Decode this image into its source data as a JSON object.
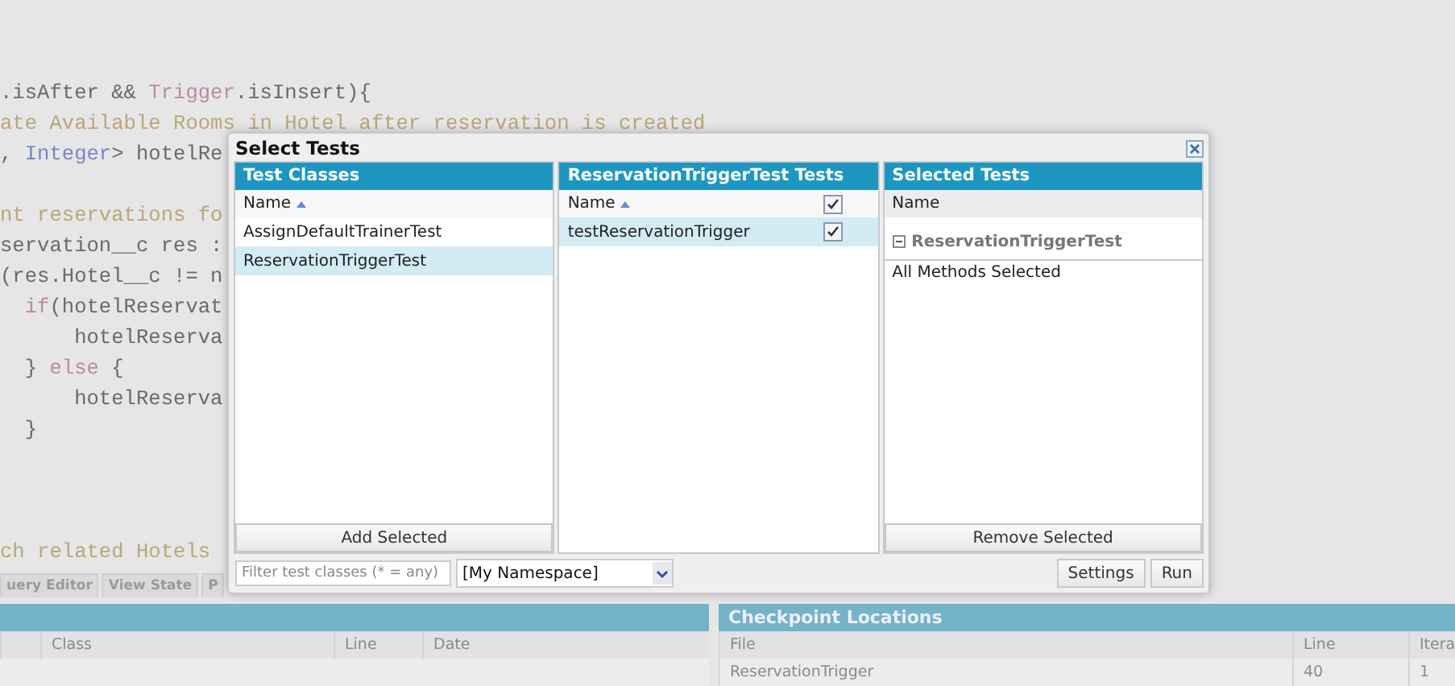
{
  "code_lines": [
    {
      "kind": "code",
      "segments": [
        {
          "text": ".isAfter && ",
          "kind": "plain"
        },
        {
          "text": "Trigger",
          "kind": "keyword"
        },
        {
          "text": ".isInsert){",
          "kind": "plain"
        }
      ]
    },
    {
      "kind": "code",
      "segments": [
        {
          "text": "ate Available Rooms in Hotel after reservation is created",
          "kind": "comment"
        }
      ]
    },
    {
      "kind": "code",
      "segments": [
        {
          "text": ", ",
          "kind": "plain"
        },
        {
          "text": "Integer",
          "kind": "type"
        },
        {
          "text": "> hotelRe",
          "kind": "plain"
        }
      ]
    },
    {
      "kind": "blank"
    },
    {
      "kind": "code",
      "segments": [
        {
          "text": "nt reservations fo",
          "kind": "comment"
        }
      ]
    },
    {
      "kind": "code",
      "segments": [
        {
          "text": "servation__c res :",
          "kind": "plain"
        }
      ]
    },
    {
      "kind": "code",
      "segments": [
        {
          "text": "(res.Hotel__c != n",
          "kind": "plain"
        }
      ]
    },
    {
      "kind": "code",
      "segments": [
        {
          "text": "  if",
          "kind": "keyword"
        },
        {
          "text": "(hotelReservat",
          "kind": "plain"
        }
      ]
    },
    {
      "kind": "code",
      "segments": [
        {
          "text": "      hotelReserva",
          "kind": "plain"
        }
      ]
    },
    {
      "kind": "code",
      "segments": [
        {
          "text": "  } ",
          "kind": "plain"
        },
        {
          "text": "else",
          "kind": "keyword"
        },
        {
          "text": " {",
          "kind": "plain"
        }
      ]
    },
    {
      "kind": "code",
      "segments": [
        {
          "text": "      hotelReserva",
          "kind": "plain"
        }
      ]
    },
    {
      "kind": "code",
      "segments": [
        {
          "text": "  }",
          "kind": "plain"
        }
      ]
    },
    {
      "kind": "blank"
    },
    {
      "kind": "blank"
    },
    {
      "kind": "blank"
    },
    {
      "kind": "code",
      "segments": [
        {
          "text": "ch related Hotels",
          "kind": "comment"
        }
      ]
    }
  ],
  "editor_tabs": [
    "uery Editor",
    "View State",
    "P"
  ],
  "bottom_panels": [
    {
      "columns": [
        "Class",
        "Line",
        "Date"
      ]
    },
    {
      "title": "Checkpoint Locations",
      "columns": [
        "File",
        "Line",
        "Itera"
      ],
      "rows": [
        [
          "ReservationTrigger",
          "40",
          "1"
        ]
      ]
    }
  ],
  "dialog": {
    "title": "Select Tests",
    "test_classes": {
      "title": "Test Classes",
      "column": "Name",
      "rows": [
        {
          "name": "AssignDefaultTrainerTest",
          "selected": false
        },
        {
          "name": "ReservationTriggerTest",
          "selected": true
        }
      ],
      "button": "Add Selected"
    },
    "class_tests": {
      "title": "ReservationTriggerTest Tests",
      "column": "Name",
      "all_checked": true,
      "rows": [
        {
          "name": "testReservationTrigger",
          "selected": true,
          "checked": true
        }
      ]
    },
    "selected_tests": {
      "title": "Selected Tests",
      "column": "Name",
      "group": "ReservationTriggerTest",
      "expanded": true,
      "items": [
        "All Methods Selected"
      ],
      "button": "Remove Selected"
    },
    "filter": {
      "placeholder": "Filter test classes (* = any)"
    },
    "namespace": "[My Namespace]",
    "buttons": [
      "Settings",
      "Run"
    ]
  }
}
